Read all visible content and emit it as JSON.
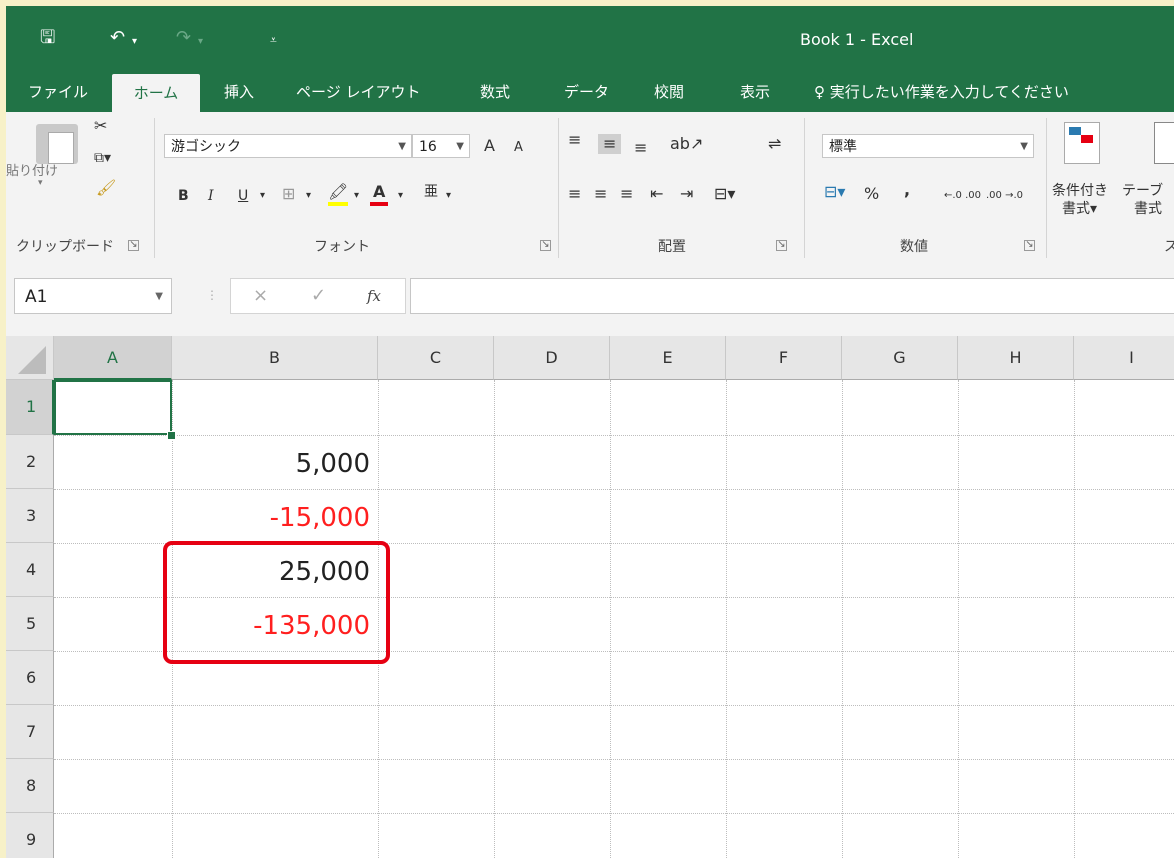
{
  "window": {
    "title": "Book 1  -  Excel"
  },
  "quick_access": {
    "save": "🖫",
    "undo": "↶",
    "redo": "↷",
    "customize": "⩡"
  },
  "tabs": [
    "ファイル",
    "ホーム",
    "挿入",
    "ページ レイアウト",
    "数式",
    "データ",
    "校閲",
    "表示"
  ],
  "tell_me": {
    "icon": "lightbulb-icon",
    "text": "実行したい作業を入力してください"
  },
  "ribbon": {
    "clipboard": {
      "paste_label": "貼り付け",
      "group_label": "クリップボード"
    },
    "font": {
      "font_name": "游ゴシック",
      "font_size": "16",
      "grow": "A",
      "shrink": "A",
      "bold": "B",
      "italic": "I",
      "underline": "U",
      "group_label": "フォント"
    },
    "alignment": {
      "group_label": "配置"
    },
    "number": {
      "format": "標準",
      "percent": "%",
      "comma": ",",
      "inc_decimal": "←.0 .00",
      "dec_decimal": ".00 →.0",
      "group_label": "数値"
    },
    "styles": {
      "cond_format_line1": "条件付き",
      "cond_format_line2": "書式▾",
      "table_line1": "テーブ",
      "table_line2": "書式",
      "group_label": "ス"
    }
  },
  "formula_bar": {
    "name_box": "A1",
    "cancel": "×",
    "enter": "✓",
    "fx": "fx",
    "formula": ""
  },
  "grid": {
    "columns": [
      "A",
      "B",
      "C",
      "D",
      "E",
      "F",
      "G",
      "H",
      "I"
    ],
    "rows": [
      "1",
      "2",
      "3",
      "4",
      "5",
      "6",
      "7",
      "8",
      "9"
    ],
    "cells": {
      "B2": "5,000",
      "B3": "-15,000",
      "B4": "25,000",
      "B5": "-135,000"
    },
    "negative_color": "#ff1f1f",
    "highlight_color": "#e60012"
  },
  "colors": {
    "excel_green": "#217346",
    "background": "#f7f1c8"
  }
}
